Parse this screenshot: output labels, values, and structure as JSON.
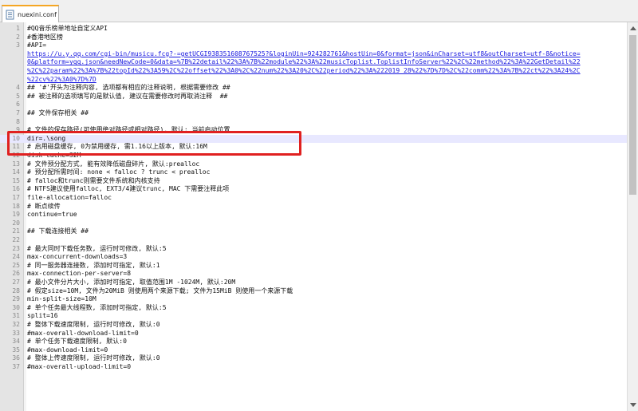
{
  "tab": {
    "label": "nuexini.conf"
  },
  "editor": {
    "lines": [
      {
        "n": "1",
        "text": "#QQ音乐榜单地址自定义API"
      },
      {
        "n": "2",
        "text": "#香港地区榜"
      },
      {
        "n": "3",
        "text": "#API="
      },
      {
        "n": "",
        "text": "https://u.y.qq.com/cgi-bin/musicu.fcg?-=getUCGI938351608767525?&loginUin=924282761&hostUin=0&format=json&inCharset=utf8&outCharset=utf-8&notice=",
        "url": true
      },
      {
        "n": "",
        "text": "0&platform=yqq.json&needNewCode=0&data=%7B%22detail%22%3A%7B%22module%22%3A%22musicToplist.ToplistInfoServer%22%2C%22method%22%3A%22GetDetail%22",
        "url": true
      },
      {
        "n": "",
        "text": "%2C%22param%22%3A%7B%22topId%22%3A59%2C%22offset%22%3A0%2C%22num%22%3A20%2C%22period%22%3A%222019_28%22%7D%7D%2C%22comm%22%3A%7B%22ct%22%3A24%2C",
        "url": true
      },
      {
        "n": "",
        "text": "%22cv%22%3A0%7D%7D",
        "url": true
      },
      {
        "n": "4",
        "text": "## '#'开头为注释内容, 选项都有相应的注释说明, 根据需要修改 ##"
      },
      {
        "n": "5",
        "text": "## 被注释的选项填写的是默认值, 建议在需要修改时再取消注释  ##"
      },
      {
        "n": "6",
        "text": ""
      },
      {
        "n": "7",
        "text": "## 文件保存相关 ##"
      },
      {
        "n": "8",
        "text": ""
      },
      {
        "n": "9",
        "text": "# 文件的保存路径(可使用绝对路径或相对路径), 默认: 当前启动位置"
      },
      {
        "n": "10",
        "text": "dir=.\\song",
        "current": true
      },
      {
        "n": "11",
        "text": "# 启用磁盘缓存, 0为禁用缓存, 需1.16以上版本, 默认:16M"
      },
      {
        "n": "12",
        "text": "disk-cache=32M"
      },
      {
        "n": "13",
        "text": "# 文件预分配方式, 能有效降低磁盘碎片, 默认:prealloc"
      },
      {
        "n": "14",
        "text": "# 预分配所需时间: none < falloc ? trunc < prealloc"
      },
      {
        "n": "15",
        "text": "# falloc和trunc则需要文件系统和内核支持"
      },
      {
        "n": "16",
        "text": "# NTFS建议使用falloc, EXT3/4建议trunc, MAC 下需要注释此项"
      },
      {
        "n": "17",
        "text": "file-allocation=falloc"
      },
      {
        "n": "18",
        "text": "# 断点续传"
      },
      {
        "n": "19",
        "text": "continue=true"
      },
      {
        "n": "20",
        "text": ""
      },
      {
        "n": "21",
        "text": "## 下载连接相关 ##"
      },
      {
        "n": "22",
        "text": ""
      },
      {
        "n": "23",
        "text": "# 最大同时下载任务数, 运行时可修改, 默认:5"
      },
      {
        "n": "24",
        "text": "max-concurrent-downloads=3"
      },
      {
        "n": "25",
        "text": "# 同一服务器连接数, 添加时可指定, 默认:1"
      },
      {
        "n": "26",
        "text": "max-connection-per-server=8"
      },
      {
        "n": "27",
        "text": "# 最小文件分片大小, 添加时可指定, 取值范围1M -1024M, 默认:20M"
      },
      {
        "n": "28",
        "text": "# 假定size=10M, 文件为20MiB 则使用两个来源下载; 文件为15MiB 则使用一个来源下载"
      },
      {
        "n": "29",
        "text": "min-split-size=10M"
      },
      {
        "n": "30",
        "text": "# 单个任务最大线程数, 添加时可指定, 默认:5"
      },
      {
        "n": "31",
        "text": "split=16"
      },
      {
        "n": "32",
        "text": "# 整体下载速度限制, 运行时可修改, 默认:0"
      },
      {
        "n": "33",
        "text": "#max-overall-download-limit=0"
      },
      {
        "n": "34",
        "text": "# 单个任务下载速度限制, 默认:0"
      },
      {
        "n": "35",
        "text": "#max-download-limit=0"
      },
      {
        "n": "36",
        "text": "# 整体上传速度限制, 运行时可修改, 默认:0"
      },
      {
        "n": "37",
        "text": "#max-overall-upload-limit=0"
      }
    ]
  },
  "colors": {
    "highlight_box": "#e02020",
    "current_line": "#e8e8ff",
    "url_text": "#1a1ae0",
    "tab_accent": "#f5a623"
  },
  "icons": {
    "tab": "text-file-icon"
  }
}
